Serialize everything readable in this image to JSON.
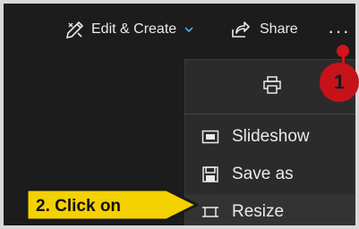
{
  "toolbar": {
    "edit_create_label": "Edit & Create",
    "share_label": "Share",
    "more_label": "···",
    "icons": {
      "edit_create": "edit-create-icon",
      "share": "share-icon",
      "chevron": "chevron-down-icon"
    }
  },
  "menu": {
    "print_icon": "print-icon",
    "items": [
      {
        "label": "Slideshow",
        "icon": "slideshow-icon"
      },
      {
        "label": "Save as",
        "icon": "save-icon"
      },
      {
        "label": "Resize",
        "icon": "resize-icon"
      }
    ]
  },
  "annotations": {
    "step1_label": "1",
    "step2_label": "2. Click on"
  },
  "colors": {
    "background": "#1c1c1c",
    "menu_bg": "#2b2b2b",
    "accent_blue": "#4aa3df",
    "marker_red": "#c8121a",
    "callout_yellow": "#f4d100"
  }
}
